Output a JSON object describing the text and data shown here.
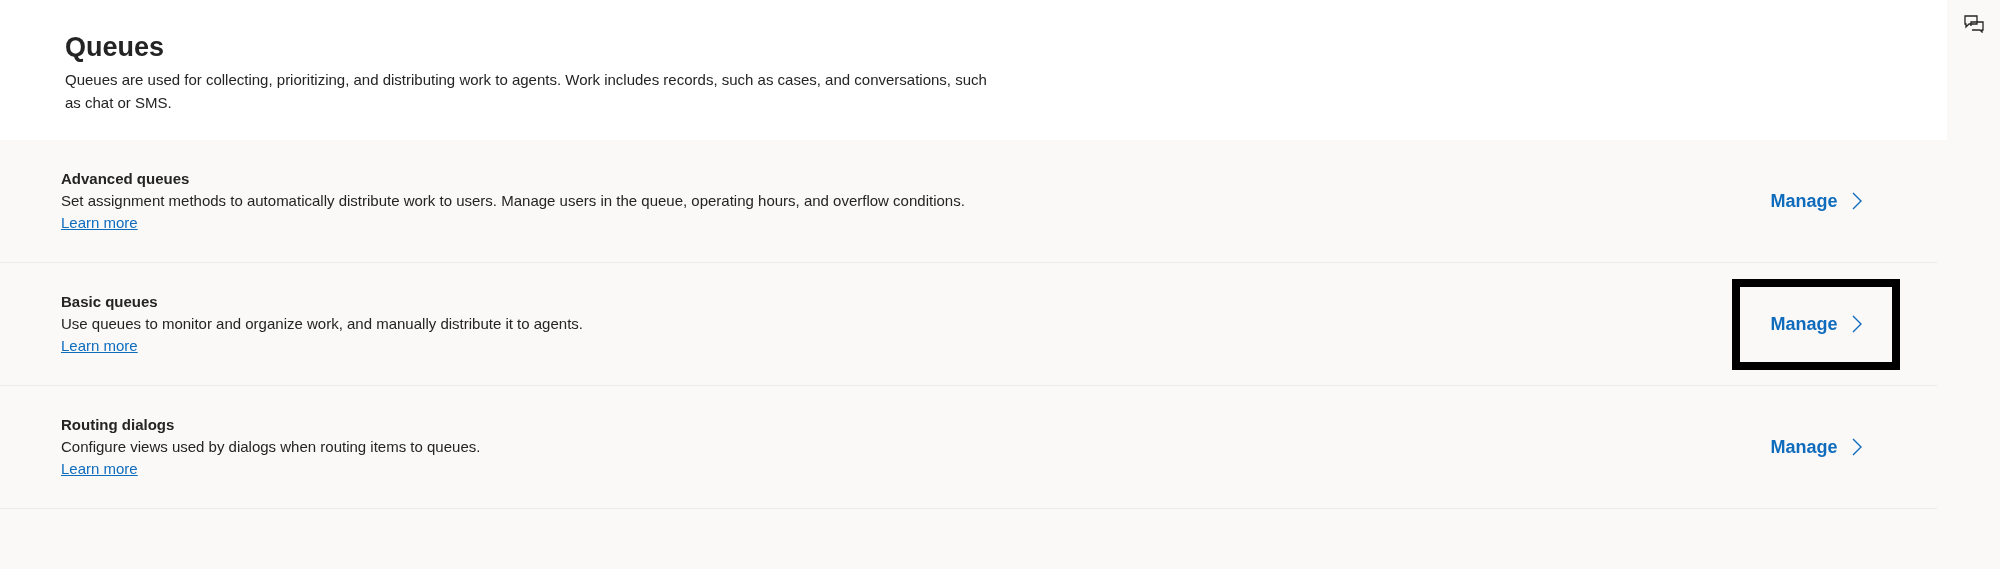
{
  "header": {
    "title": "Queues",
    "description": "Queues are used for collecting, prioritizing, and distributing work to agents. Work includes records, such as cases, and conversations, such as chat or SMS."
  },
  "sections": [
    {
      "title": "Advanced queues",
      "description": "Set assignment methods to automatically distribute work to users. Manage users in the queue, operating hours, and overflow conditions.",
      "link": "Learn more",
      "action": "Manage",
      "highlighted": false
    },
    {
      "title": "Basic queues",
      "description": "Use queues to monitor and organize work, and manually distribute it to agents.",
      "link": "Learn more",
      "action": "Manage",
      "highlighted": true
    },
    {
      "title": "Routing dialogs",
      "description": "Configure views used by dialogs when routing items to queues.",
      "link": "Learn more",
      "action": "Manage",
      "highlighted": false
    }
  ]
}
